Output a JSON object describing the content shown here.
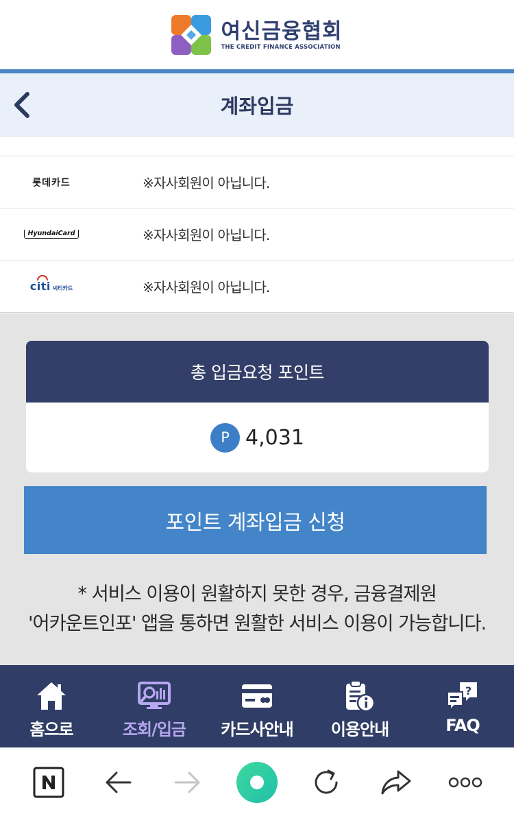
{
  "header": {
    "logo_title": "여신금융협회",
    "logo_subtitle": "THE CREDIT FINANCE ASSOCIATION"
  },
  "titlebar": {
    "title": "계좌입금"
  },
  "card_rows": [
    {
      "brand": "롯데카드",
      "message": "※자사회원이 아닙니다."
    },
    {
      "brand": "HyundaiCard",
      "message": "※자사회원이 아닙니다."
    },
    {
      "brand_main": "citi",
      "brand_kr": "씨티카드",
      "message": "※자사회원이 아닙니다."
    }
  ],
  "points": {
    "header": "총 입금요청 포인트",
    "badge": "P",
    "value": "4,031"
  },
  "apply_button": "포인트 계좌입금 신청",
  "notice": {
    "line1": "* 서비스 이용이 원활하지 못한 경우, 금융결제원",
    "line2": "'어카운트인포' 앱을 통하면 원활한 서비스 이용이 가능합니다."
  },
  "bottom_nav": [
    {
      "label": "홈으로",
      "icon": "home-icon"
    },
    {
      "label": "조회/입금",
      "icon": "inquiry-icon",
      "active": true
    },
    {
      "label": "카드사안내",
      "icon": "card-icon"
    },
    {
      "label": "이용안내",
      "icon": "clipboard-info-icon"
    },
    {
      "label": "FAQ",
      "icon": "faq-icon"
    }
  ],
  "browser_bar": {
    "icons": [
      "naver-icon",
      "back-arrow-icon",
      "forward-arrow-icon",
      "home-circle-icon",
      "refresh-icon",
      "share-icon",
      "more-icon"
    ]
  },
  "colors": {
    "navy": "#303d66",
    "accent_blue": "#4385c8",
    "active_nav": "#b7a6f0",
    "title_bg": "#e9f0f9"
  }
}
